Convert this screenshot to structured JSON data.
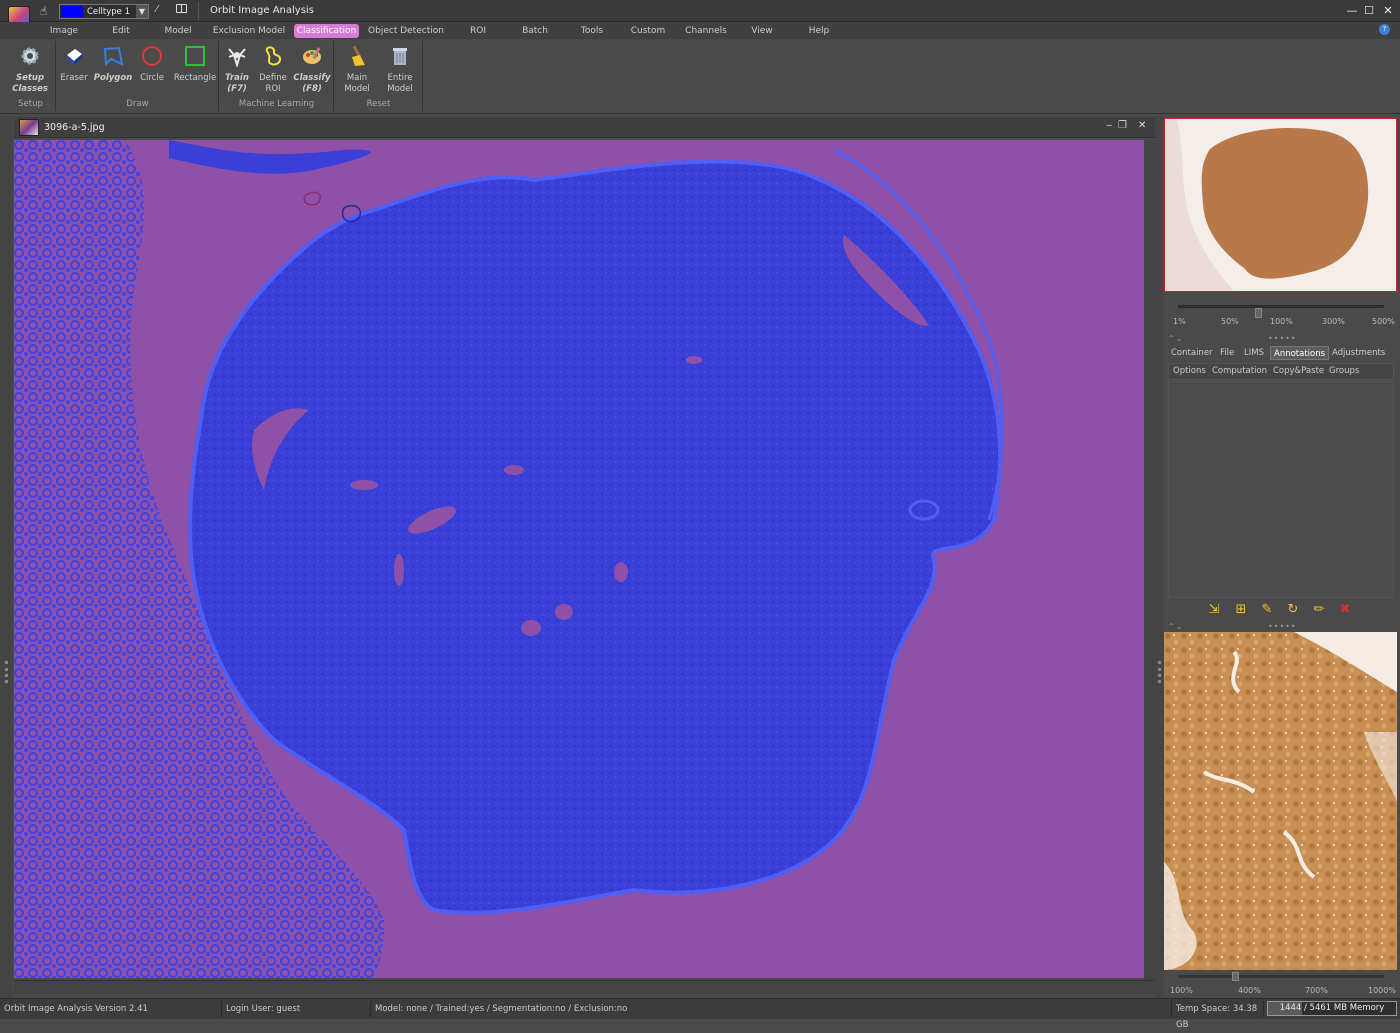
{
  "window": {
    "title": "Orbit Image Analysis",
    "class_selector": {
      "selected": "Celltype 1",
      "swatch_color": "#0000ff"
    },
    "controls": {
      "minimize": "—",
      "maximize": "☐",
      "close": "✕"
    }
  },
  "menu": {
    "items": [
      {
        "label": "Image",
        "active": false
      },
      {
        "label": "Edit",
        "active": false
      },
      {
        "label": "Model",
        "active": false
      },
      {
        "label": "Exclusion Model",
        "active": false
      },
      {
        "label": "Classification",
        "active": true
      },
      {
        "label": "Object Detection",
        "active": false
      },
      {
        "label": "ROI",
        "active": false
      },
      {
        "label": "Batch",
        "active": false
      },
      {
        "label": "Tools",
        "active": false
      },
      {
        "label": "Custom",
        "active": false
      },
      {
        "label": "Channels",
        "active": false
      },
      {
        "label": "View",
        "active": false
      },
      {
        "label": "Help",
        "active": false
      }
    ],
    "help_icon": "?"
  },
  "ribbon": {
    "groups": [
      {
        "label": "Setup"
      },
      {
        "label": "Draw"
      },
      {
        "label": "Machine Learning"
      },
      {
        "label": "Reset"
      }
    ],
    "buttons": {
      "setup_classes": [
        "Setup",
        "Classes"
      ],
      "eraser": [
        "Eraser"
      ],
      "polygon": [
        "Polygon"
      ],
      "circle": [
        "Circle"
      ],
      "rectangle": [
        "Rectangle"
      ],
      "train": [
        "Train",
        "(F7)"
      ],
      "define_roi": [
        "Define",
        "ROI"
      ],
      "classify": [
        "Classify",
        "(F8)"
      ],
      "main_model": [
        "Main",
        "Model"
      ],
      "entire_model": [
        "Entire",
        "Model"
      ]
    }
  },
  "document": {
    "title": "3096-a-5.jpg",
    "controls": {
      "minimize": "‒",
      "restore": "❐",
      "close": "✕"
    },
    "overlay_colors": {
      "background_class": "#8e51a7",
      "celltype_class": "#3a3fd8"
    }
  },
  "side_panel": {
    "zoom_ticks": [
      "1%",
      "50%",
      "100%",
      "300%",
      "500%"
    ],
    "zoom_value": 0.38,
    "tabs": [
      {
        "label": "Container",
        "active": false
      },
      {
        "label": "File",
        "active": false
      },
      {
        "label": "LIMS",
        "active": false
      },
      {
        "label": "Annotations",
        "active": true
      },
      {
        "label": "Adjustments",
        "active": false
      }
    ],
    "subtabs": [
      "Options",
      "Computation",
      "Copy&Paste",
      "Groups"
    ],
    "annotation_tools": [
      "import-icon",
      "add-icon",
      "edit-group-icon",
      "refresh-icon",
      "pencil-icon",
      "delete-icon"
    ],
    "detail_zoom_ticks": [
      "100%",
      "400%",
      "700%",
      "1000%"
    ],
    "detail_zoom_value": 0.27
  },
  "status": {
    "version": "Orbit Image Analysis Version 2.41",
    "login": "Login User: guest",
    "model": "Model: none / Trained:yes / Segmentation:no / Exclusion:no",
    "temp_space": "Temp Space: 34.38 GB",
    "memory": "1444 / 5461 MB Memory",
    "memory_fraction": 0.264
  }
}
